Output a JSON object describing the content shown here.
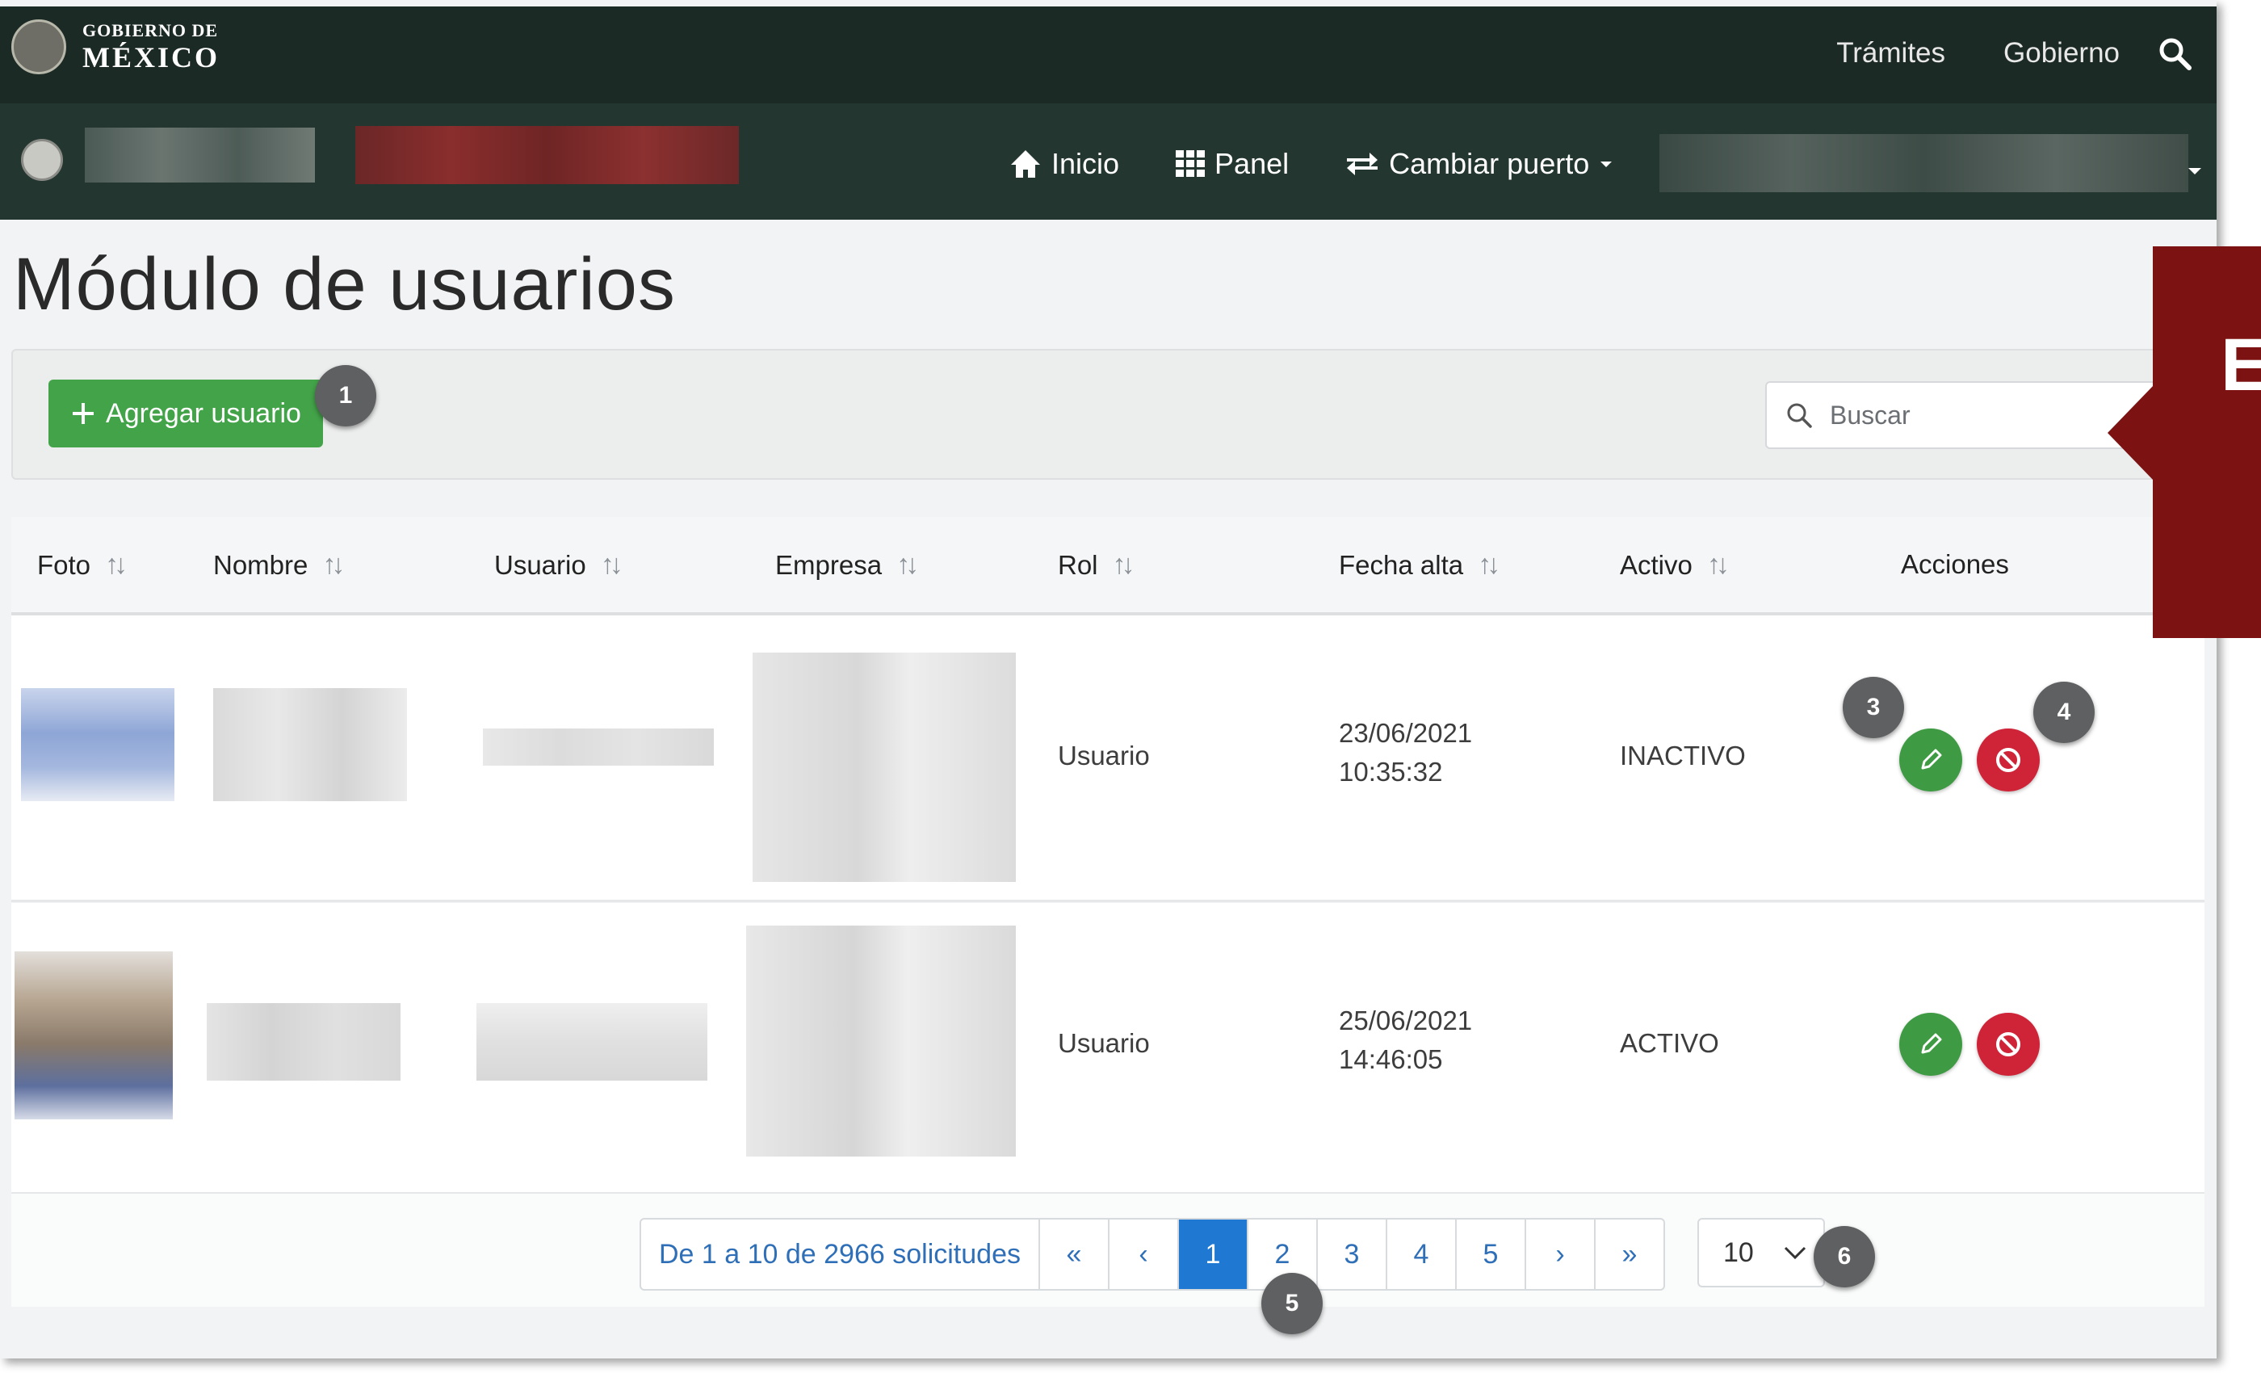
{
  "header": {
    "gov_small": "GOBIERNO DE",
    "gov_big": "MÉXICO",
    "links": [
      "Trámites",
      "Gobierno"
    ]
  },
  "nav": {
    "inicio": "Inicio",
    "panel": "Panel",
    "cambiar_puerto": "Cambiar puerto"
  },
  "page": {
    "title": "Módulo de usuarios"
  },
  "toolbar": {
    "add_label": "Agregar usuario",
    "search_placeholder": "Buscar"
  },
  "table": {
    "columns": [
      "Foto",
      "Nombre",
      "Usuario",
      "Empresa",
      "Rol",
      "Fecha alta",
      "Activo",
      "Acciones"
    ],
    "rows": [
      {
        "rol": "Usuario",
        "fecha": "23/06/2021",
        "hora": "10:35:32",
        "activo": "INACTIVO"
      },
      {
        "rol": "Usuario",
        "fecha": "25/06/2021",
        "hora": "14:46:05",
        "activo": "ACTIVO"
      }
    ]
  },
  "pagination": {
    "info": "De 1 a 10 de 2966 solicitudes",
    "first": "«",
    "prev": "‹",
    "pages": [
      "1",
      "2",
      "3",
      "4",
      "5"
    ],
    "active_page": "1",
    "next": "›",
    "last": "»",
    "per_page": "10"
  },
  "badges": [
    "1",
    "3",
    "4",
    "5",
    "6"
  ],
  "callout_letter": "E",
  "colors": {
    "topbar": "#1c2a25",
    "navbar": "#233630",
    "add_button": "#43a349",
    "edit_button": "#3f9b43",
    "disable_button": "#cf2338",
    "active_page": "#1f78d1",
    "callout": "#7c1212"
  }
}
